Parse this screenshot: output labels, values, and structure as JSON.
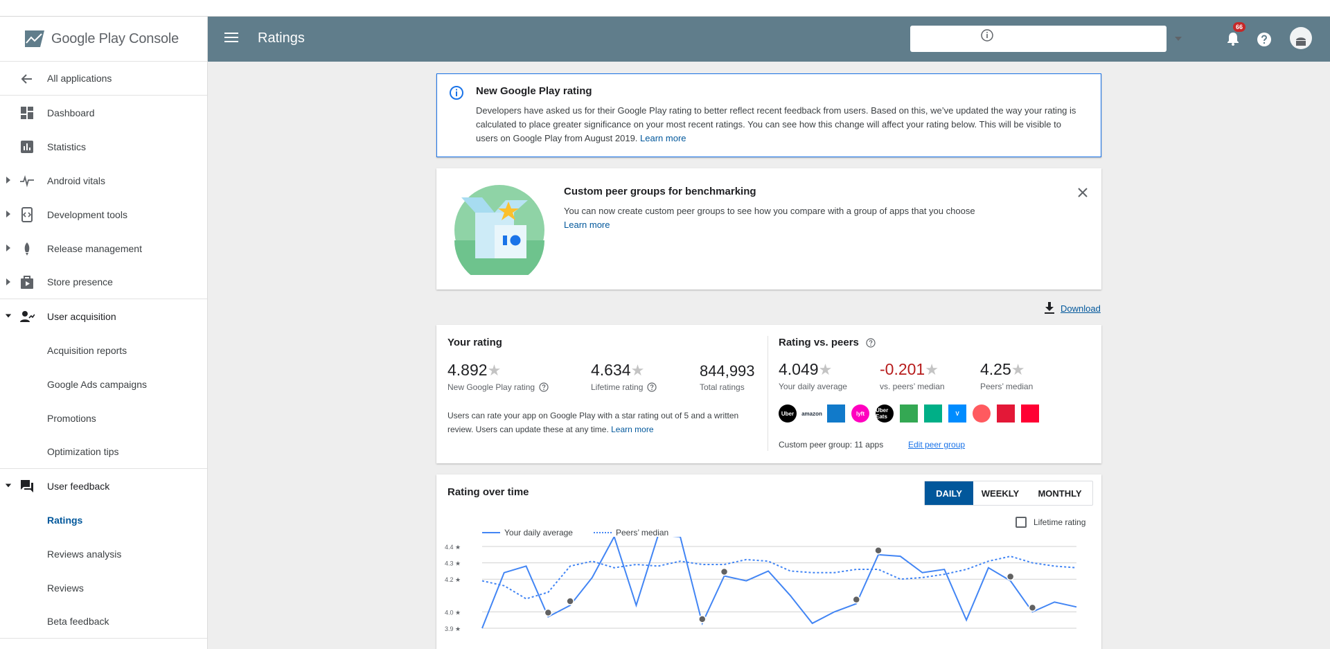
{
  "brand": {
    "text_google_play": "Google Play",
    "text_console": " Console"
  },
  "sidebar": {
    "back": "All applications",
    "items": [
      {
        "label": "Dashboard",
        "icon": "dashboard-icon"
      },
      {
        "label": "Statistics",
        "icon": "bar-chart-icon"
      },
      {
        "label": "Android vitals",
        "icon": "pulse-icon"
      },
      {
        "label": "Development tools",
        "icon": "code-icon"
      },
      {
        "label": "Release management",
        "icon": "rocket-icon"
      },
      {
        "label": "Store presence",
        "icon": "play-store-icon"
      },
      {
        "label": "User acquisition",
        "icon": "person-add-icon"
      },
      {
        "label": "Acquisition reports"
      },
      {
        "label": "Google Ads campaigns"
      },
      {
        "label": "Promotions"
      },
      {
        "label": "Optimization tips"
      },
      {
        "label": "User feedback",
        "icon": "forum-icon"
      },
      {
        "label": "Ratings"
      },
      {
        "label": "Reviews analysis"
      },
      {
        "label": "Reviews"
      },
      {
        "label": "Beta feedback"
      }
    ]
  },
  "topbar": {
    "title": "Ratings",
    "app_select_value": "",
    "notifications_count": "66",
    "bg_color": "#607d8b"
  },
  "notice": {
    "title": "New Google Play rating",
    "body": "Developers have asked us for their Google Play rating to better reflect recent feedback from users. Based on this, we’ve updated the way your rating is calculated to place greater significance on your most recent ratings. You can see how this change will affect your rating below. This will be visible to users on Google Play from August 2019. ",
    "link": "Learn more"
  },
  "promo": {
    "title": "Custom peer groups for benchmarking",
    "body": "You can now create custom peer groups to see how you compare with a group of apps that you choose",
    "link": "Learn more"
  },
  "download_label": "Download",
  "your_rating": {
    "title": "Your rating",
    "new_rating_value": "4.892",
    "new_rating_label": "New Google Play rating",
    "lifetime_value": "4.634",
    "lifetime_label": "Lifetime rating",
    "total_value": "844,993",
    "total_label": "Total ratings",
    "description": "Users can rate your app on Google Play with a star rating out of 5 and a written review. Users can update these at any time. ",
    "link": "Learn more"
  },
  "peers": {
    "title": "Rating vs. peers",
    "daily_value": "4.049",
    "daily_label": "Your daily average",
    "vs_value": "-0.201",
    "vs_label": "vs. peers’ median",
    "median_value": "4.25",
    "median_label": "Peers’ median",
    "apps": [
      {
        "name": "Uber",
        "color": "#000000",
        "shape": "round"
      },
      {
        "name": "amazon",
        "color": "#ffffff",
        "text_color": "#232f3e",
        "shape": "square"
      },
      {
        "name": "",
        "color": "#117aca",
        "shape": "square"
      },
      {
        "name": "lyft",
        "color": "#ff00bf",
        "shape": "round"
      },
      {
        "name": "Uber Eats",
        "color": "#000000",
        "shape": "round"
      },
      {
        "name": "",
        "color": "#34a853",
        "shape": "square"
      },
      {
        "name": "",
        "color": "#00af87",
        "shape": "square"
      },
      {
        "name": "V",
        "color": "#008cff",
        "shape": "square"
      },
      {
        "name": "",
        "color": "#ff5a5f",
        "shape": "round"
      },
      {
        "name": "",
        "color": "#e31837",
        "shape": "square"
      },
      {
        "name": "",
        "color": "#ff0033",
        "shape": "square"
      }
    ],
    "group_label": "Custom peer group: 11 apps",
    "edit_label": "Edit peer group"
  },
  "rating_over_time": {
    "title": "Rating over time",
    "tabs": [
      "DAILY",
      "WEEKLY",
      "MONTHLY"
    ],
    "active_tab": "DAILY",
    "lifetime_checkbox_label": "Lifetime rating",
    "legend": [
      "Your daily average",
      "Peers’ median"
    ]
  },
  "chart_data": {
    "type": "line",
    "y_ticks": [
      "4.4 ★",
      "4.3 ★",
      "4.2 ★",
      "4.0 ★",
      "3.9 ★"
    ],
    "ylim": [
      3.9,
      4.4
    ],
    "series": [
      {
        "name": "Your daily average",
        "style": "solid",
        "color": "#4285f4",
        "values": [
          3.9,
          4.24,
          4.28,
          3.97,
          4.04,
          4.21,
          4.46,
          4.04,
          4.47,
          4.46,
          3.93,
          4.22,
          4.19,
          4.25,
          4.1,
          3.93,
          4.0,
          4.05,
          4.35,
          4.34,
          4.24,
          4.26,
          3.95,
          4.27,
          4.19,
          4.0,
          4.06,
          4.03
        ]
      },
      {
        "name": "Peers’ median",
        "style": "dotted",
        "color": "#4285f4",
        "values": [
          4.19,
          4.16,
          4.08,
          4.12,
          4.28,
          4.31,
          4.27,
          4.29,
          4.28,
          4.31,
          4.29,
          4.29,
          4.32,
          4.31,
          4.25,
          4.24,
          4.24,
          4.26,
          4.26,
          4.2,
          4.21,
          4.23,
          4.26,
          4.31,
          4.34,
          4.3,
          4.28,
          4.27
        ]
      }
    ],
    "markers": [
      3,
      4,
      10,
      11,
      17,
      18,
      24,
      25
    ]
  }
}
